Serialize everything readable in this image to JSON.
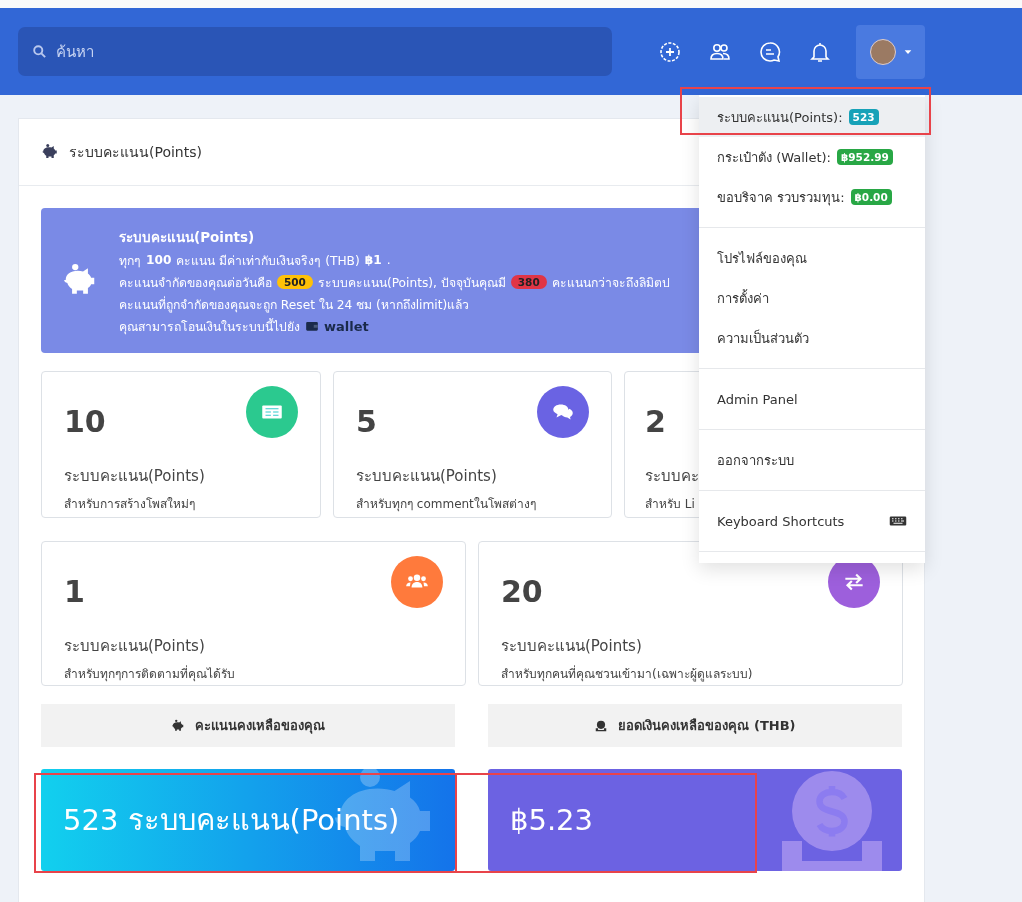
{
  "header": {
    "search": {
      "placeholder": "ค้นหา"
    },
    "menu_open": true
  },
  "panel": {
    "title": "ระบบคะแนน(Points)"
  },
  "info": {
    "title": "ระบบคะแนน(Points)",
    "line_1": "ทุกๆ **100** คะแนน มีค่าเท่ากับเงินจริงๆ (THB) **฿1**.",
    "line_2": [
      {
        "kind": "text",
        "text": "คะแนนจำกัดของคุณต่อวันคือ"
      },
      {
        "kind": "badge",
        "text": "500",
        "color": "#ffc107"
      },
      {
        "kind": "text",
        "text": "ระบบคะแนน(Points), ปัจจุบันคุณมี"
      },
      {
        "kind": "badge",
        "text": "380",
        "color": "#e03546"
      },
      {
        "kind": "text",
        "text": "คะแนนกว่าจะถึงลิมิตป"
      }
    ],
    "line_3": "คะแนนที่ถูกจำกัดของคุณจะถูก Reset ใน 24 ชม (หากถึงlimit)แล้ว",
    "line_4": "คุณสามารถโอนเงินในระบบนี้ไปยัง",
    "link": "wallet"
  },
  "rewards": [
    {
      "value": "10",
      "label": "ระบบคะแนน(Points)",
      "caption": "สำหรับการสร้างโพสใหม่ๆ",
      "kind": "post",
      "color": "#2bc98f"
    },
    {
      "value": "5",
      "label": "ระบบคะแนน(Points)",
      "caption": "สำหรับทุกๆ commentในโพสต่างๆ",
      "kind": "comment",
      "color": "#6a63e3"
    },
    {
      "value": "2",
      "label": "ระบบคะ",
      "caption": "สำหรับ Li",
      "kind": "hidden"
    },
    {
      "value": "1",
      "label": "ระบบคะแนน(Points)",
      "caption": "สำหรับทุกๆการติดตามที่คุณได้รับ",
      "kind": "follow",
      "color": "#ff7a3c"
    },
    {
      "value": "20",
      "label": "ระบบคะแนน(Points)",
      "caption": "สำหรับทุกคนที่คุณชวนเข้ามา(เฉพาะผู้ดูแลระบบ)",
      "kind": "invite",
      "color": "#9d5fdc"
    }
  ],
  "balances": [
    {
      "heading": "คะแนนคงเหลือของคุณ",
      "amount": "523 ระบบคะแนน(Points)",
      "kind": "points",
      "highlighted": true
    },
    {
      "heading": "ยอดเงินคงเหลือของคุณ (THB)",
      "amount": "฿5.23",
      "kind": "money",
      "highlighted": true
    }
  ],
  "menu": [
    {
      "kind": "badge",
      "label": "ระบบคะแนน(Points):",
      "badge": "523",
      "color": "#17a2b8",
      "hovered": true,
      "highlighted": true
    },
    {
      "kind": "badge",
      "label": "กระเป๋าตัง (Wallet):",
      "badge": "฿952.99",
      "color": "#28a745",
      "hovered": false,
      "highlighted": false
    },
    {
      "kind": "badge",
      "label": "ขอบริจาค รวบรวมทุน:",
      "badge": "฿0.00",
      "color": "#28a745",
      "hovered": false,
      "highlighted": false
    },
    {
      "kind": "divider"
    },
    {
      "kind": "plain",
      "label": "โปรไฟล์ของคุณ",
      "hovered": false,
      "highlighted": false
    },
    {
      "kind": "plain",
      "label": "การตั้งค่า",
      "hovered": false,
      "highlighted": false
    },
    {
      "kind": "plain",
      "label": "ความเป็นส่วนตัว",
      "hovered": false,
      "highlighted": false
    },
    {
      "kind": "divider"
    },
    {
      "kind": "plain",
      "label": "Admin Panel",
      "hovered": false,
      "highlighted": false
    },
    {
      "kind": "divider"
    },
    {
      "kind": "plain",
      "label": "ออกจากระบบ",
      "hovered": false,
      "highlighted": false
    },
    {
      "kind": "divider"
    },
    {
      "kind": "keyboard",
      "label": "Keyboard Shortcuts",
      "hovered": false,
      "highlighted": false
    },
    {
      "kind": "divider"
    }
  ]
}
